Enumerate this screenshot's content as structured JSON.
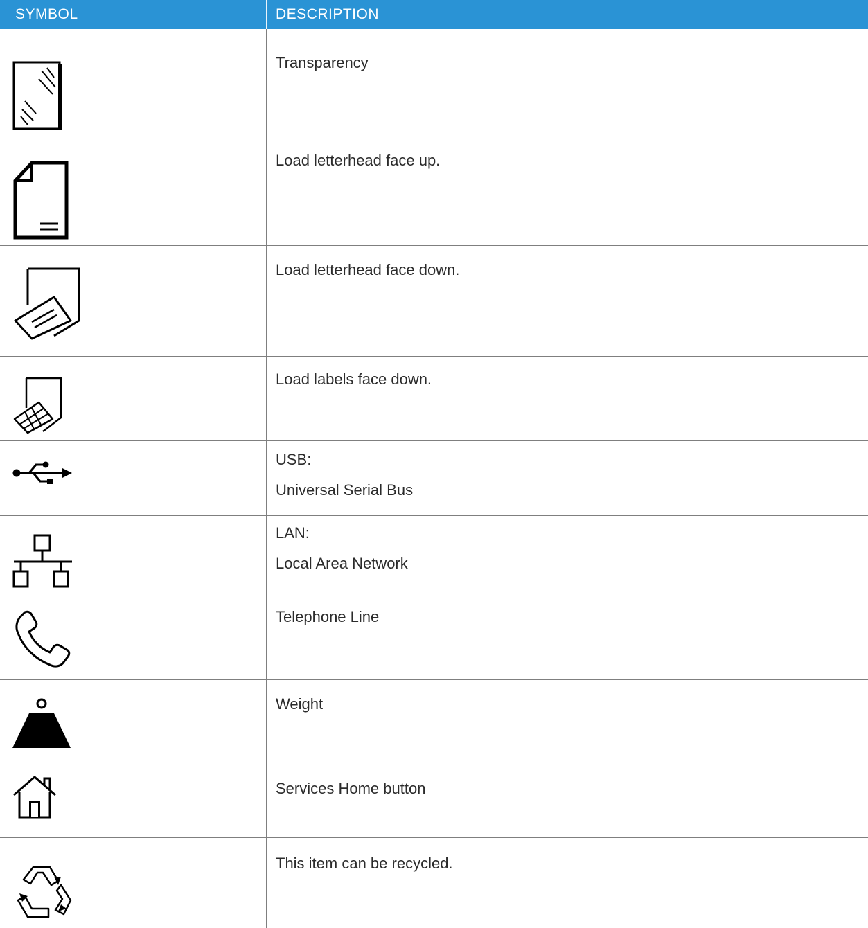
{
  "header": {
    "symbol": "SYMBOL",
    "description": "DESCRIPTION"
  },
  "colors": {
    "header_bg": "#2a93d5",
    "header_text": "#ffffff",
    "rule": "#7f7f7f"
  },
  "rows": [
    {
      "icon": "transparency-icon",
      "lines": [
        "Transparency"
      ]
    },
    {
      "icon": "letterhead-face-up-icon",
      "lines": [
        "Load letterhead face up."
      ]
    },
    {
      "icon": "letterhead-face-down-icon",
      "lines": [
        "Load letterhead face down."
      ]
    },
    {
      "icon": "labels-face-down-icon",
      "lines": [
        "Load labels face down."
      ]
    },
    {
      "icon": "usb-icon",
      "lines": [
        "USB:",
        "Universal Serial Bus"
      ]
    },
    {
      "icon": "lan-icon",
      "lines": [
        "LAN:",
        "Local Area Network"
      ]
    },
    {
      "icon": "telephone-line-icon",
      "lines": [
        "Telephone Line"
      ]
    },
    {
      "icon": "weight-icon",
      "lines": [
        "Weight"
      ]
    },
    {
      "icon": "services-home-icon",
      "lines": [
        "Services Home button"
      ]
    },
    {
      "icon": "recycle-icon",
      "lines": [
        "This item can be recycled."
      ]
    }
  ]
}
